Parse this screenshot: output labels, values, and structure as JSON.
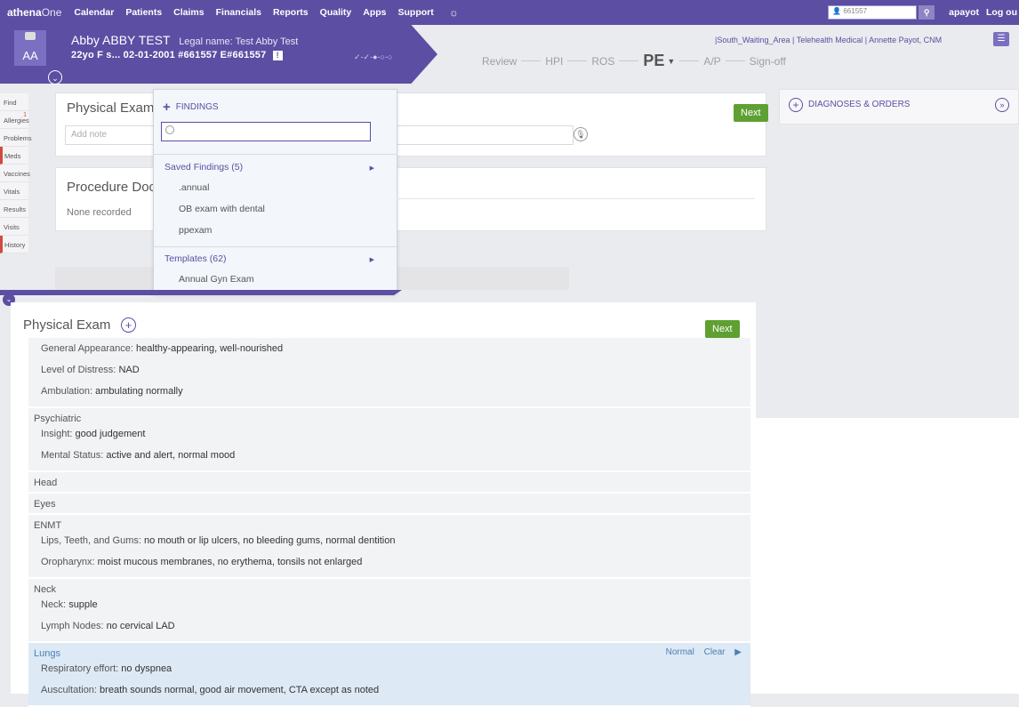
{
  "topnav": {
    "logo_a": "athena",
    "logo_b": "One",
    "links": [
      "Calendar",
      "Patients",
      "Claims",
      "Financials",
      "Reports",
      "Quality",
      "Apps",
      "Support"
    ],
    "gear_icon": "gear-icon",
    "patient_search_value": "661557",
    "user": "apayot",
    "logout": "Log ou"
  },
  "banner": {
    "initials": "AA",
    "name": "Abby ABBY TEST",
    "legal_name": "Legal name: Test Abby Test",
    "info": "22yo F  s...  02-01-2001  #661557  E#661557",
    "flag": "!",
    "progress_dots": "✓-✓-●-○-○"
  },
  "steps": {
    "review": "Review",
    "hpi": "HPI",
    "ros": "ROS",
    "pe": "PE",
    "ap": "A/P",
    "signoff": "Sign-off"
  },
  "provider_line": "|South_Waiting_Area | Telehealth Medical | Annette Payot, CNM",
  "sidebar": [
    "Find",
    "Allergies",
    "Problems",
    "Meds",
    "Vaccines",
    "Vitals",
    "Results",
    "Visits",
    "History"
  ],
  "sidebar_badge": "1",
  "upper_pe": {
    "title": "Physical Exam",
    "add_note_placeholder": "Add note",
    "next": "Next"
  },
  "procedure": {
    "title": "Procedure Doc",
    "none": "None recorded"
  },
  "dx_orders": {
    "label": "DIAGNOSES & ORDERS"
  },
  "findings": {
    "header": "FINDINGS",
    "saved_label": "Saved Findings (5)",
    "saved_items": [
      ".annual",
      "OB exam with dental",
      "ppexam"
    ],
    "templates_label": "Templates (62)",
    "template_items": [
      "Annual Gyn Exam"
    ]
  },
  "main_pe": {
    "title": "Physical Exam",
    "next": "Next",
    "groups": [
      {
        "title": "",
        "rows": [
          {
            "k": "General Appearance:",
            "v": "healthy-appearing, well-nourished"
          },
          {
            "k": "Level of Distress:",
            "v": "NAD"
          },
          {
            "k": "Ambulation:",
            "v": "ambulating normally"
          }
        ]
      },
      {
        "title": "Psychiatric",
        "rows": [
          {
            "k": "Insight:",
            "v": "good judgement"
          },
          {
            "k": "Mental Status:",
            "v": "active and alert, normal mood"
          }
        ]
      },
      {
        "title": "Head",
        "rows": []
      },
      {
        "title": "Eyes",
        "rows": []
      },
      {
        "title": "ENMT",
        "rows": [
          {
            "k": "Lips, Teeth, and Gums:",
            "v": "no mouth or lip ulcers, no bleeding gums, normal dentition"
          },
          {
            "k": "Oropharynx:",
            "v": "moist mucous membranes, no erythema, tonsils not enlarged"
          }
        ]
      },
      {
        "title": "Neck",
        "rows": [
          {
            "k": "Neck:",
            "v": "supple"
          },
          {
            "k": "Lymph Nodes:",
            "v": "no cervical LAD"
          }
        ]
      },
      {
        "title": "Lungs",
        "highlight": true,
        "actions": [
          "Normal",
          "Clear"
        ],
        "rows": [
          {
            "k": "Respiratory effort:",
            "v": "no dyspnea"
          },
          {
            "k": "Auscultation:",
            "v": "breath sounds normal, good air movement, CTA except as noted"
          }
        ]
      }
    ]
  }
}
